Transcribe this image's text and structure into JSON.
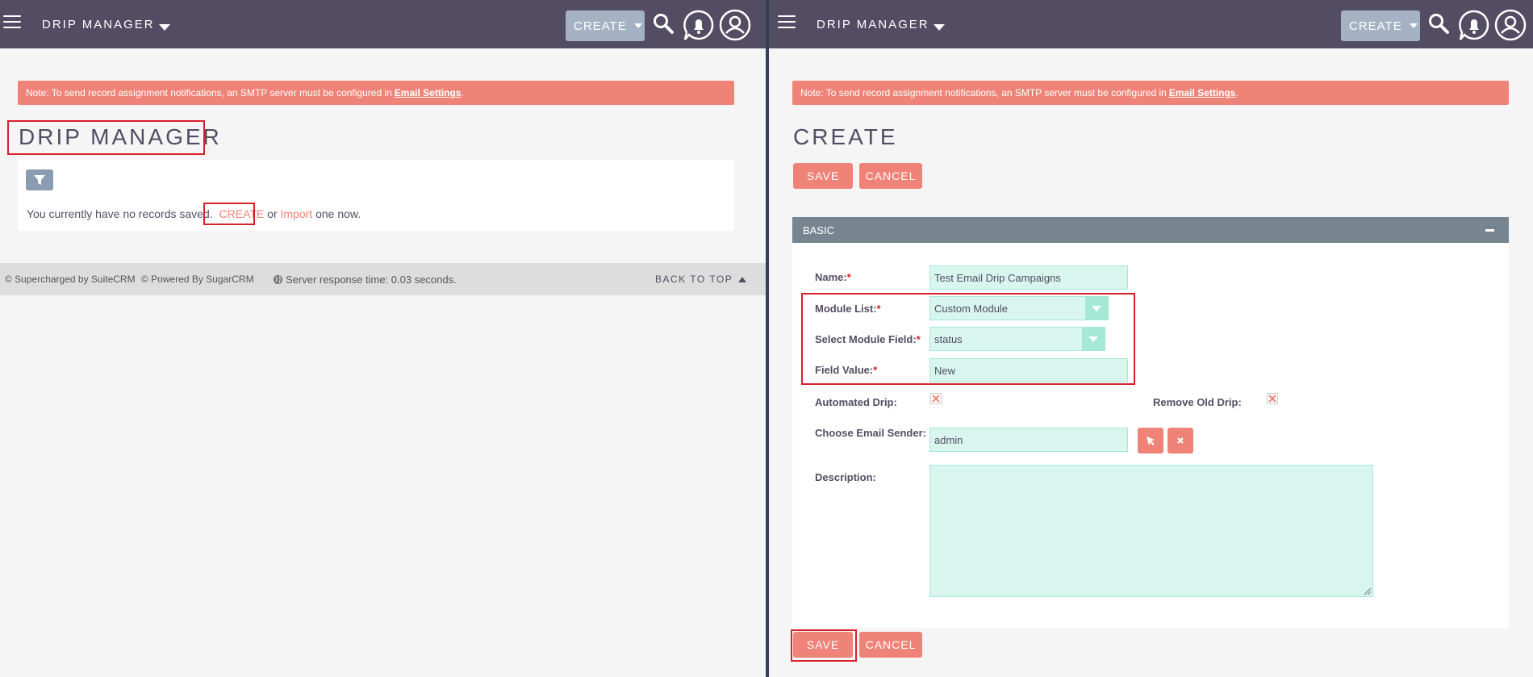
{
  "left": {
    "nav": {
      "module_label": "DRIP MANAGER",
      "create_label": "CREATE"
    },
    "alert": {
      "text": "Note: To send record assignment notifications, an SMTP server must be configured in",
      "link": "Email Settings",
      "suffix": "."
    },
    "title": "DRIP MANAGER",
    "listview": {
      "empty_prefix": "You currently have no records saved.",
      "create_link": "CREATE",
      "or": "or",
      "import_link": "Import",
      "suffix": "one now."
    },
    "footer": {
      "suitecrm": "© Supercharged by SuiteCRM",
      "sugarcrm": "© Powered By SugarCRM",
      "response": "Server response time: 0.03 seconds.",
      "back_to_top": "BACK TO TOP"
    }
  },
  "right": {
    "nav": {
      "module_label": "DRIP MANAGER",
      "create_label": "CREATE"
    },
    "alert": {
      "text": "Note: To send record assignment notifications, an SMTP server must be configured in",
      "link": "Email Settings",
      "suffix": "."
    },
    "title": "CREATE",
    "buttons": {
      "save": "SAVE",
      "cancel": "CANCEL"
    },
    "panel": {
      "title": "BASIC"
    },
    "fields": {
      "name": {
        "label": "Name:",
        "required": "*",
        "value": "Test Email Drip Campaigns"
      },
      "module_list": {
        "label": "Module List:",
        "required": "*",
        "value": "Custom Module"
      },
      "module_field": {
        "label": "Select Module Field:",
        "required": "*",
        "value": "status"
      },
      "field_value": {
        "label": "Field Value:",
        "required": "*",
        "value": "New"
      },
      "automated_drip": {
        "label": "Automated Drip:"
      },
      "remove_old_drip": {
        "label": "Remove Old Drip:"
      },
      "email_sender": {
        "label": "Choose Email Sender:",
        "value": "admin"
      },
      "description": {
        "label": "Description:",
        "value": ""
      }
    }
  },
  "colors": {
    "navbar": "#534d64",
    "accent": "#f08377",
    "highlight": "#d8202a",
    "input_bg": "#d8f5ee",
    "panel_header": "#778591"
  },
  "icons": {
    "menu": "hamburger-icon",
    "search": "search-icon",
    "notifications": "bell-icon",
    "profile": "user-icon",
    "filter": "filter-icon",
    "globe": "globe-icon",
    "select": "cursor-arrow-icon",
    "clear": "close-icon"
  }
}
